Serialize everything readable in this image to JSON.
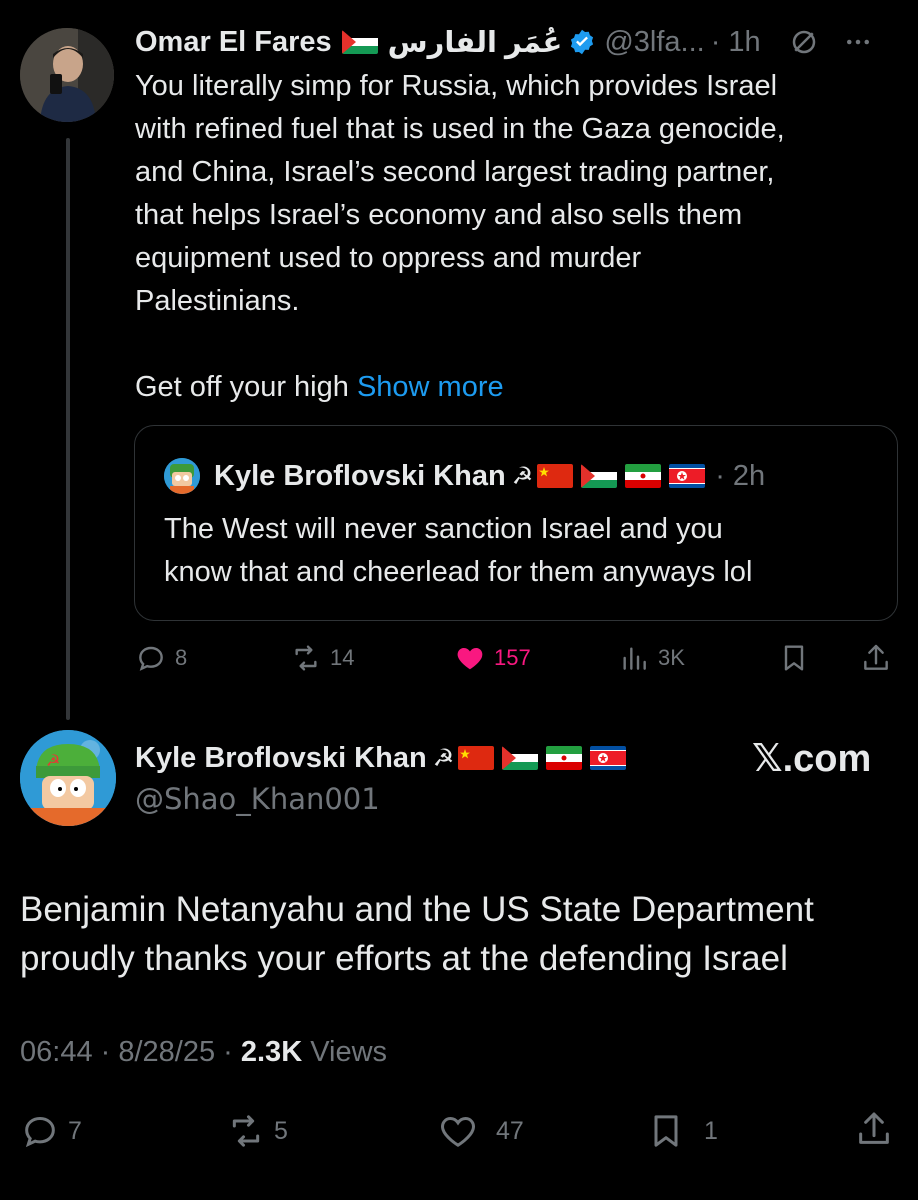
{
  "tweet1": {
    "name": "Omar El Fares",
    "arabic_name": "عُمَر الفارس",
    "handle": "@3lfa...",
    "time": "· 1h",
    "body": "You literally simp for Russia, which provides Israel\nwith refined fuel that is used in the Gaza genocide,\nand China, Israel’s second largest trading partner,\nthat helps Israel’s economy and also sells them\nequipment used to oppress and murder\nPalestinians.\n\nGet off your high ",
    "show_more": "Show more",
    "quote": {
      "name": "Kyle Broflovski Khan",
      "time": "· 2h",
      "body": "The West will never sanction Israel and you\nknow that and cheerlead for them anyways lol"
    },
    "actions": {
      "replies": "8",
      "reposts": "14",
      "likes": "157",
      "views": "3K"
    }
  },
  "tweet2": {
    "name": "Kyle Broflovski Khan",
    "handle": "@Shao_Khan001",
    "brand": "𝕏.com",
    "body": "Benjamin Netanyahu and the US State Department\nproudly thanks your efforts at the defending Israel",
    "time": "06:44 · 8/28/25 · ",
    "views_count": "2.3K",
    "views_label": " Views",
    "actions": {
      "replies": "7",
      "reposts": "5",
      "likes": "47",
      "bookmarks": "1"
    }
  },
  "colors": {
    "accent": "#1d9bf0",
    "like": "#f91880",
    "muted": "#71767b"
  },
  "icons": [
    "reply-icon",
    "repost-icon",
    "like-icon",
    "views-icon",
    "bookmark-icon",
    "share-icon",
    "verified-icon",
    "mute-icon",
    "more-icon"
  ]
}
